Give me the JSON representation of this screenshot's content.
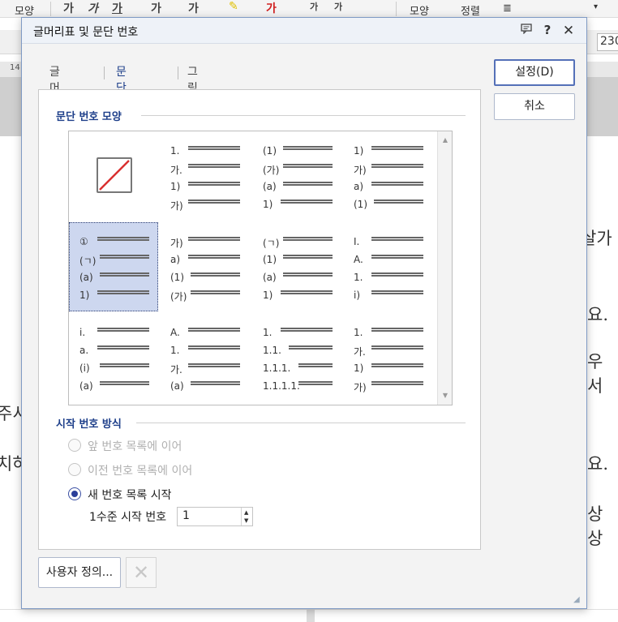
{
  "app": {
    "toolbar": {
      "shape_left": "모양",
      "shape_right": "모양",
      "align": "정렬",
      "zoom": "230"
    },
    "ruler_number": "14",
    "doc_fragments": [
      "살가",
      "요.",
      "우서",
      "주서",
      "치하",
      "요.",
      "상상"
    ]
  },
  "dialog": {
    "title": "글머리표 및 문단 번호",
    "tabs": [
      "글머리표",
      "문단 번호",
      "그림 글머리표"
    ],
    "active_tab": 1,
    "group_shape_title": "문단 번호 모양",
    "group_start_title": "시작 번호 방식",
    "options": [
      {
        "label": "앞 번호 목록에 이어",
        "enabled": false,
        "checked": false
      },
      {
        "label": "이전 번호 목록에 이어",
        "enabled": false,
        "checked": false
      },
      {
        "label": "새 번호 목록 시작",
        "enabled": true,
        "checked": true
      }
    ],
    "start_label": "1수준 시작 번호",
    "start_value": "1",
    "buttons": {
      "ok": "설정(D)",
      "cancel": "취소",
      "custom": "사용자 정의..."
    },
    "styles": [
      {
        "type": "none",
        "markers": []
      },
      {
        "type": "list",
        "markers": [
          "1.",
          "가.",
          "1)",
          "가)"
        ]
      },
      {
        "type": "list",
        "markers": [
          "(1)",
          "(가)",
          "(a)",
          "1)"
        ]
      },
      {
        "type": "list",
        "markers": [
          "1)",
          "가)",
          "a)",
          "(1)"
        ]
      },
      {
        "type": "list",
        "markers": [
          "①",
          "(ㄱ)",
          "(a)",
          "1)"
        ]
      },
      {
        "type": "list",
        "markers": [
          "가)",
          "a)",
          "(1)",
          "(가)"
        ]
      },
      {
        "type": "list",
        "markers": [
          "(ㄱ)",
          "(1)",
          "(a)",
          "1)"
        ]
      },
      {
        "type": "list",
        "markers": [
          "I.",
          "A.",
          "1.",
          "i)"
        ]
      },
      {
        "type": "list",
        "markers": [
          "i.",
          "a.",
          "(i)",
          "(a)"
        ]
      },
      {
        "type": "list",
        "markers": [
          "A.",
          "1.",
          "가.",
          "(a)"
        ]
      },
      {
        "type": "list",
        "markers": [
          "1.",
          "1.1.",
          "1.1.1.",
          "1.1.1.1."
        ]
      },
      {
        "type": "list",
        "markers": [
          "1.",
          "가.",
          "1)",
          "가)"
        ]
      }
    ],
    "selected_style": 4,
    "colors": {
      "accent": "#2c56b6",
      "selected_bg": "#cdd7ef",
      "none_slash": "#d93030"
    }
  }
}
